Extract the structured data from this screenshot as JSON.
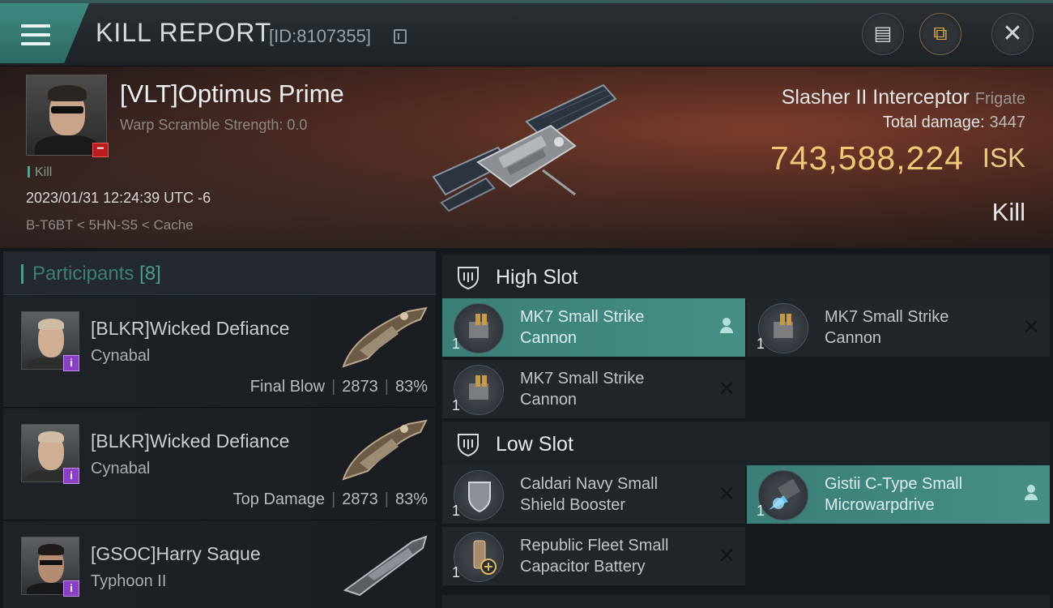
{
  "header": {
    "title": "KILL REPORT",
    "report_id": "[ID:8107355]",
    "icons": {
      "menu": "hamburger-menu-icon",
      "copy": "copy-icon",
      "notes": "notes-icon",
      "share": "share-icon",
      "close": "close-icon"
    }
  },
  "victim": {
    "name": "[VLT]Optimus Prime",
    "warp_scramble": "Warp Scramble Strength: 0.0",
    "kill_tag": "Kill",
    "datetime": "2023/01/31 12:24:39 UTC -6",
    "location": "B-T6BT < 5HN-S5 < Cache",
    "ship": "Slasher II Interceptor",
    "ship_class": "Frigate",
    "total_damage_label": "Total damage:",
    "total_damage": "3447",
    "isk_value": "743,588,224",
    "isk_label": "ISK",
    "result": "Kill"
  },
  "participants": {
    "label": "Participants",
    "count": "[8]",
    "rows": [
      {
        "name": "[BLKR]Wicked Defiance",
        "ship": "Cynabal",
        "role": "Final Blow",
        "damage": "2873",
        "percent": "83%"
      },
      {
        "name": "[BLKR]Wicked Defiance",
        "ship": "Cynabal",
        "role": "Top Damage",
        "damage": "2873",
        "percent": "83%"
      },
      {
        "name": "[GSOC]Harry Saque",
        "ship": "Typhoon II",
        "role": "",
        "damage": "",
        "percent": ""
      }
    ]
  },
  "fitting": {
    "high_slot": {
      "label": "High Slot",
      "modules": [
        {
          "name": "MK7 Small Strike Cannon",
          "qty": "1",
          "state": "fitted"
        },
        {
          "name": "MK7 Small Strike Cannon",
          "qty": "1",
          "state": "destroyed"
        },
        {
          "name": "MK7 Small Strike Cannon",
          "qty": "1",
          "state": "destroyed"
        }
      ]
    },
    "low_slot": {
      "label": "Low Slot",
      "modules": [
        {
          "name": "Caldari Navy Small Shield Booster",
          "qty": "1",
          "state": "destroyed"
        },
        {
          "name": "Gistii C-Type Small Microwarpdrive",
          "qty": "1",
          "state": "fitted"
        },
        {
          "name": "Republic Fleet Small Capacitor Battery",
          "qty": "1",
          "state": "destroyed"
        }
      ]
    }
  },
  "colors": {
    "accent": "#468e86",
    "isk": "#f0c774",
    "badge_purple": "#8b3fc4",
    "badge_red": "#b81e1e"
  }
}
